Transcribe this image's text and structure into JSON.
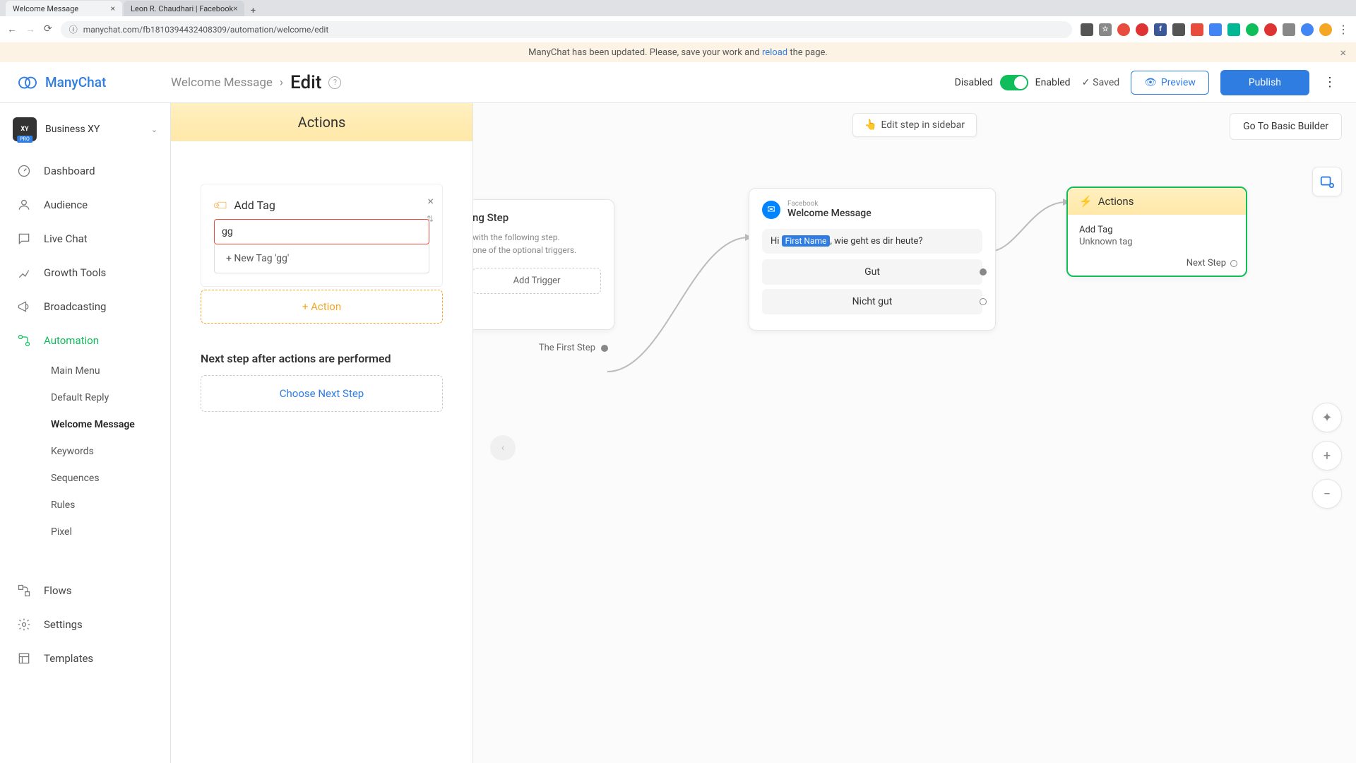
{
  "browser": {
    "tab1": "Welcome Message",
    "tab2": "Leon R. Chaudhari | Facebook",
    "url": "manychat.com/fb181039443240830​9/automation/welcome/edit"
  },
  "banner": {
    "prefix": "ManyChat has been updated. Please, save your work and ",
    "link": "reload",
    "suffix": " the page."
  },
  "header": {
    "logo": "ManyChat",
    "crumb1": "Welcome Message",
    "crumb2": "Edit",
    "disabled": "Disabled",
    "enabled": "Enabled",
    "saved": "Saved",
    "preview": "Preview",
    "publish": "Publish"
  },
  "sidebar": {
    "workspace": "Business XY",
    "nav": {
      "dashboard": "Dashboard",
      "audience": "Audience",
      "livechat": "Live Chat",
      "growth": "Growth Tools",
      "broadcasting": "Broadcasting",
      "automation": "Automation",
      "flows": "Flows",
      "settings": "Settings",
      "templates": "Templates"
    },
    "sub": {
      "mainmenu": "Main Menu",
      "defaultreply": "Default Reply",
      "welcome": "Welcome Message",
      "keywords": "Keywords",
      "sequences": "Sequences",
      "rules": "Rules",
      "pixel": "Pixel"
    }
  },
  "panel": {
    "title": "Actions",
    "addTag": "Add Tag",
    "tagValue": "gg",
    "newTag": "+ New Tag 'gg'",
    "addAction": "+ Action",
    "nextLabel": "Next step after actions are performed",
    "chooseNext": "Choose Next Step"
  },
  "canvas": {
    "editSidebar": "Edit step in sidebar",
    "goBasic": "Go To Basic Builder",
    "start": {
      "title": "ng Step",
      "desc1": "with the following step.",
      "desc2": "one of the optional triggers.",
      "addTrigger": "Add Trigger",
      "firstStep": "The First Step"
    },
    "msg": {
      "platform": "Facebook",
      "title": "Welcome Message",
      "greetPrefix": "Hi ",
      "firstName": "First Name",
      "greetSuffix": ", wie geht es dir heute?",
      "opt1": "Gut",
      "opt2": "Nicht gut"
    },
    "actionsNode": {
      "title": "Actions",
      "l1": "Add Tag",
      "l2": "Unknown tag",
      "next": "Next Step"
    }
  }
}
